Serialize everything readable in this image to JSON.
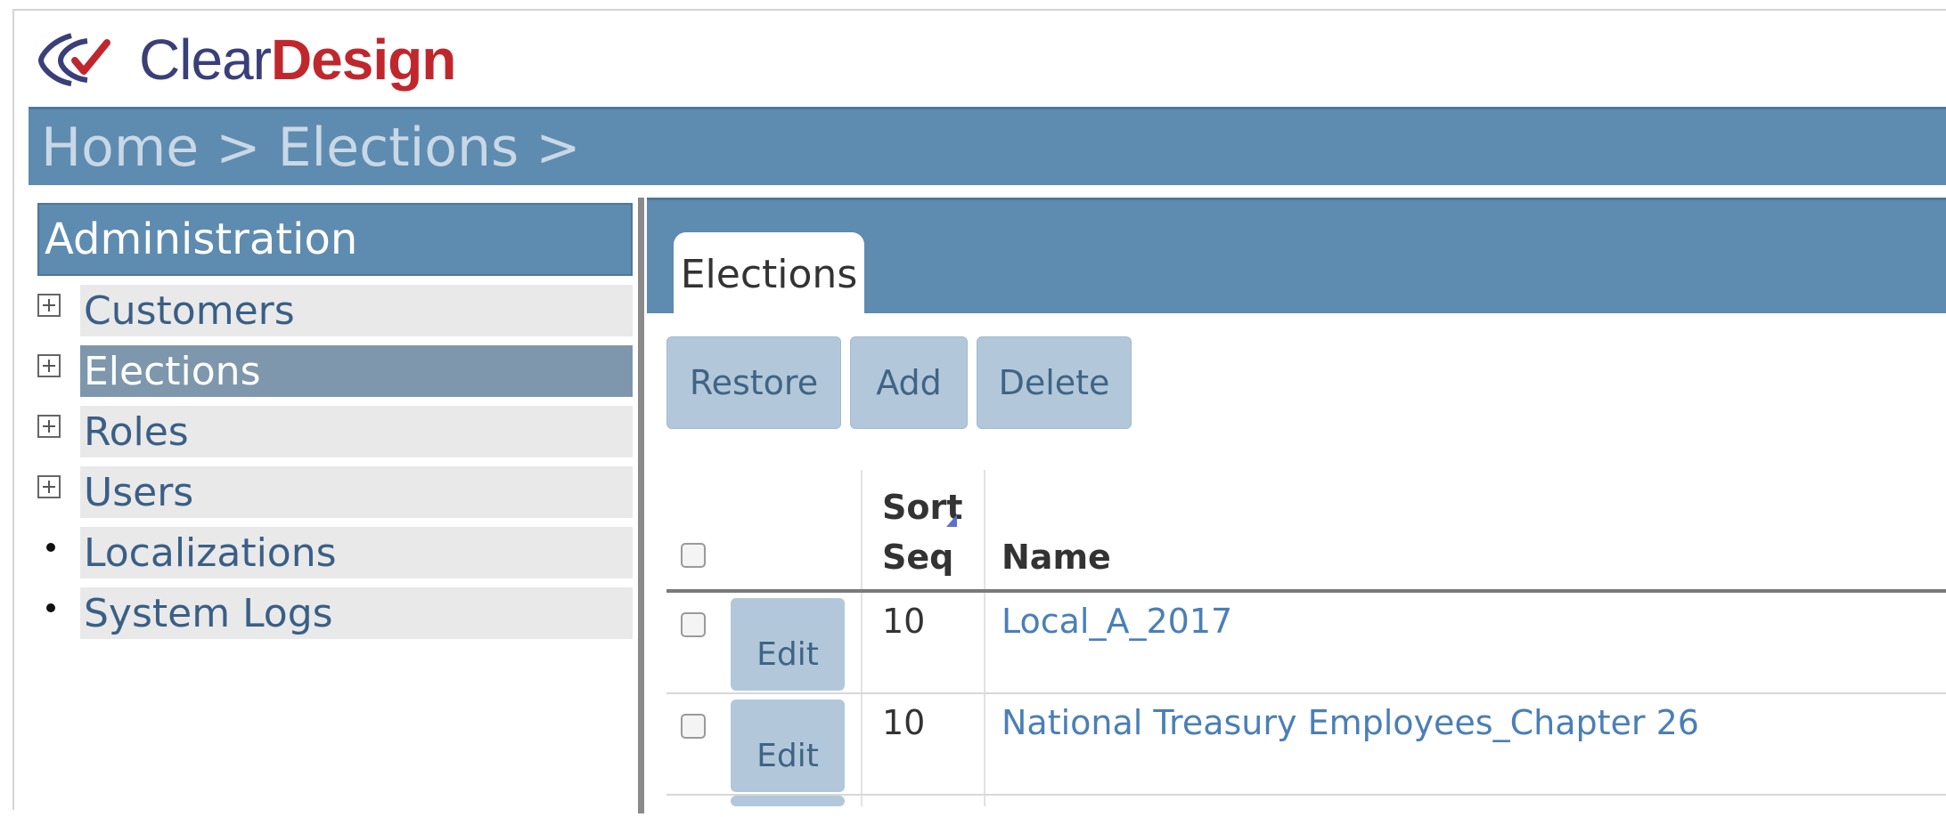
{
  "logo": {
    "text_clear": "Clear",
    "text_design": "Design",
    "icon": "eye-check-icon"
  },
  "breadcrumb": {
    "text": "Home > Elections >"
  },
  "sidebar": {
    "title": "Administration",
    "items": [
      {
        "label": "Customers",
        "marker": "expand",
        "active": false
      },
      {
        "label": "Elections",
        "marker": "expand",
        "active": true
      },
      {
        "label": "Roles",
        "marker": "expand",
        "active": false
      },
      {
        "label": "Users",
        "marker": "expand",
        "active": false
      },
      {
        "label": "Localizations",
        "marker": "bullet",
        "active": false
      },
      {
        "label": "System Logs",
        "marker": "bullet",
        "active": false
      }
    ]
  },
  "main": {
    "tab": "Elections",
    "toolbar": {
      "restore": "Restore",
      "add": "Add",
      "delete": "Delete"
    },
    "grid": {
      "headers": {
        "sort_seq_line1": "Sort",
        "sort_seq_line2": "Seq",
        "name": "Name"
      },
      "edit_label": "Edit",
      "rows": [
        {
          "sort_seq": "10",
          "name": "Local_A_2017"
        },
        {
          "sort_seq": "10",
          "name": "National Treasury Employees_Chapter 26"
        }
      ]
    }
  },
  "colors": {
    "bar": "#5e8bb0",
    "button": "#b2c8da",
    "link": "#4a7fb6",
    "active_item": "#7e97ad",
    "brand_red": "#c0272d",
    "brand_blue": "#3a3f7a"
  }
}
